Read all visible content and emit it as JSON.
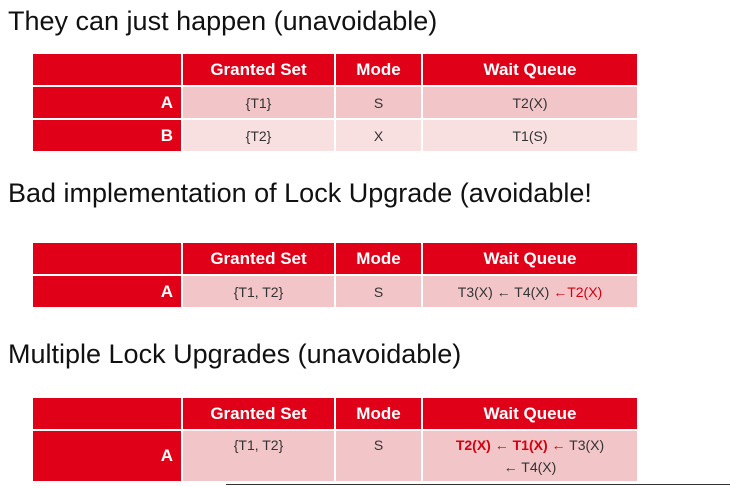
{
  "sections": [
    {
      "heading": "They can just happen (unavoidable)",
      "table": {
        "headers": [
          "",
          "Granted Set",
          "Mode",
          "Wait Queue"
        ],
        "rows": [
          {
            "label": "A",
            "granted": "{T1}",
            "mode": "S",
            "wait": "T2(X)"
          },
          {
            "label": "B",
            "granted": "{T2}",
            "mode": "X",
            "wait": "T1(S)"
          }
        ]
      }
    },
    {
      "heading": "Bad implementation of Lock Upgrade (avoidable!",
      "table": {
        "headers": [
          "",
          "Granted Set",
          "Mode",
          "Wait Queue"
        ],
        "rows": [
          {
            "label": "A",
            "granted": "{T1, T2}",
            "mode": "S",
            "wait_parts": [
              "T3(X) ← T4(X) ",
              "←T2(X)"
            ]
          }
        ]
      }
    },
    {
      "heading": "Multiple Lock Upgrades (unavoidable)",
      "table": {
        "headers": [
          "",
          "Granted Set",
          "Mode",
          "Wait Queue"
        ],
        "rows": [
          {
            "label": "A",
            "granted": "{T1, T2}",
            "mode": "S",
            "wait_parts": [
              "T2(X) ← T1(X) ←",
              " T3(X)",
              "← T4(X)"
            ]
          }
        ]
      }
    }
  ],
  "colors": {
    "header_red": "#e00018",
    "cell_pink_dark": "#f2c6c8",
    "cell_pink_light": "#f8dfe0",
    "highlight_red": "#d40010",
    "text_blue": "#2f4f8a"
  }
}
